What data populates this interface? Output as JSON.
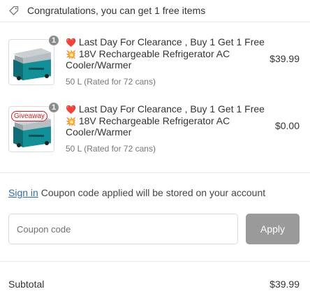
{
  "promo": {
    "icon": "tag-icon",
    "text": "Congratulations, you can get 1 free items"
  },
  "items": [
    {
      "title_emoji_1": "❤️",
      "title_text_1": "Last Day For Clearance , Buy 1 Get 1 Free",
      "title_emoji_2": "💥",
      "title_text_2": "18V Rechargeable Refrigerator AC Cooler/Warmer",
      "variant": "50 L  (Rated for 72 cans)",
      "price": "$39.99",
      "quantity": "1",
      "giveaway": ""
    },
    {
      "title_emoji_1": "❤️",
      "title_text_1": "Last Day For Clearance , Buy 1 Get 1 Free",
      "title_emoji_2": "💥",
      "title_text_2": "18V Rechargeable Refrigerator AC Cooler/Warmer",
      "variant": "50 L  (Rated for 72 cans)",
      "price": "$0.00",
      "quantity": "1",
      "giveaway": "Giveaway"
    }
  ],
  "account": {
    "signin_link": "Sign in",
    "signin_note": " Coupon code applied will be stored on your account"
  },
  "coupon": {
    "placeholder": "Coupon code",
    "apply_label": "Apply"
  },
  "summary": {
    "subtotal_label": "Subtotal",
    "subtotal_value": "$39.99"
  },
  "colors": {
    "badge": "#8c8c8c",
    "apply_button": "#9a9a9a",
    "link": "#2a6fb0",
    "giveaway": "#d61c1c",
    "product_teal": "#0f7f86"
  }
}
